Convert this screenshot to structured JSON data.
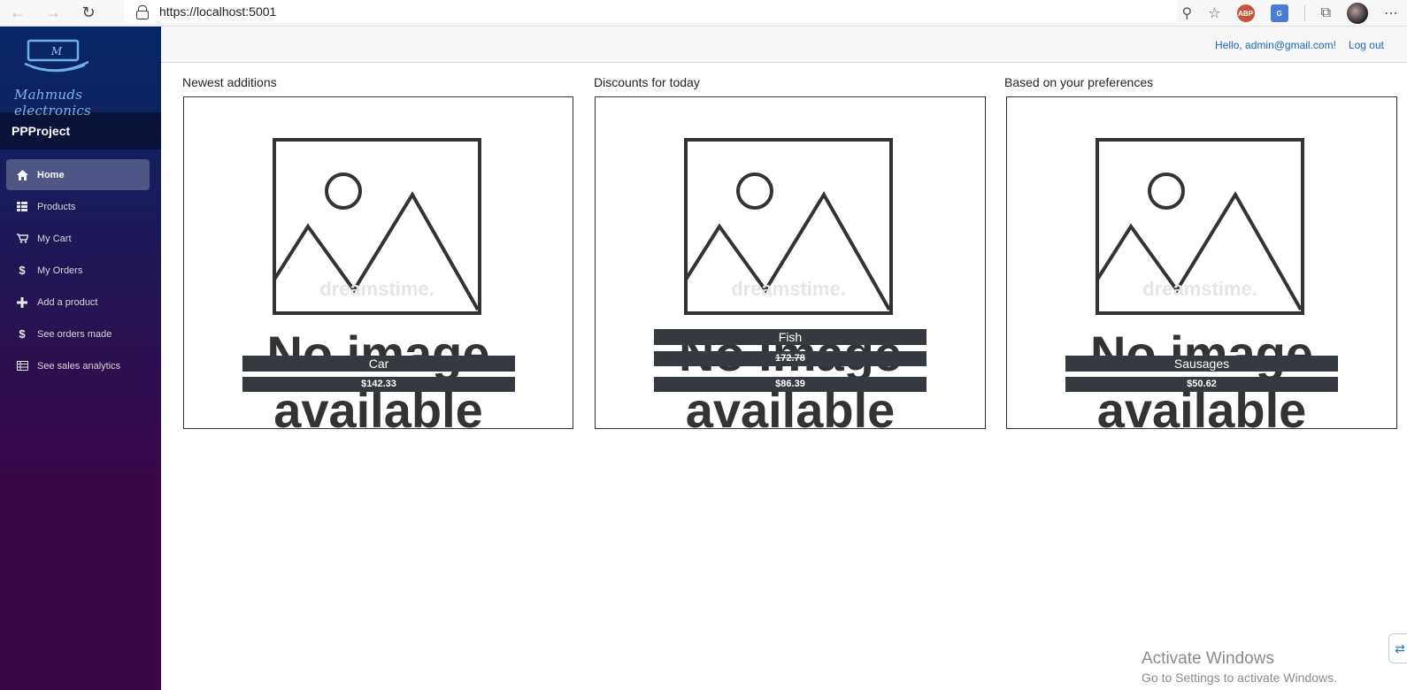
{
  "browser": {
    "url": "https://localhost:5001"
  },
  "sidebar": {
    "logo_text": "Mahmuds electronics",
    "logo_mark": "M",
    "brand": "PPProject",
    "items": [
      {
        "label": "Home",
        "icon": "home-icon"
      },
      {
        "label": "Products",
        "icon": "list-icon"
      },
      {
        "label": "My Cart",
        "icon": "cart-icon"
      },
      {
        "label": "My Orders",
        "icon": "dollar-icon"
      },
      {
        "label": "Add a product",
        "icon": "plus-icon"
      },
      {
        "label": "See orders made",
        "icon": "dollar-icon"
      },
      {
        "label": "See sales analytics",
        "icon": "table-icon"
      }
    ]
  },
  "top": {
    "greeting": "Hello, admin@gmail.com!",
    "logout": "Log out"
  },
  "sections": [
    {
      "title": "Newest additions",
      "product": {
        "name": "Car",
        "old_price": "",
        "price": "$142.33"
      }
    },
    {
      "title": "Discounts for today",
      "product": {
        "name": "Fish",
        "old_price": "172.78",
        "price": "$86.39"
      }
    },
    {
      "title": "Based on your preferences",
      "product": {
        "name": "Sausages",
        "old_price": "",
        "price": "$50.62"
      }
    }
  ],
  "placeholder": {
    "line1": "No image",
    "line2": "available",
    "watermark": "dreamstime."
  },
  "watermark": {
    "line1": "Activate Windows",
    "line2": "Go to Settings to activate Windows."
  }
}
